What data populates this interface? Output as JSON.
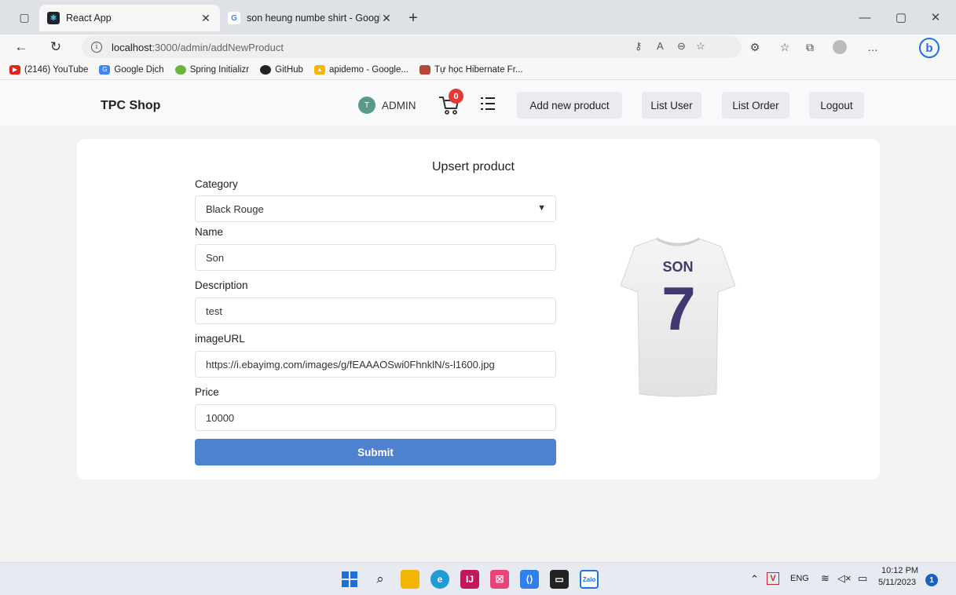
{
  "browser": {
    "tabs": [
      {
        "title": "React App",
        "active": true
      },
      {
        "title": "son heung numbe shirt - Google",
        "active": false
      }
    ],
    "url_host": "localhost",
    "url_rest": ":3000/admin/addNewProduct",
    "bookmarks": [
      {
        "label": "(2146) YouTube",
        "color": "#e62117"
      },
      {
        "label": "Google Dịch",
        "color": "#4285f4"
      },
      {
        "label": "Spring Initializr",
        "color": "#6db33f"
      },
      {
        "label": "GitHub",
        "color": "#222222"
      },
      {
        "label": "apidemo - Google...",
        "color": "#f4b400"
      },
      {
        "label": "Tự học Hibernate Fr...",
        "color": "#b24a3a"
      }
    ]
  },
  "navbar": {
    "brand": "TPC Shop",
    "avatar_initial": "T",
    "user_label": "ADMIN",
    "cart_count": "0",
    "buttons": [
      "Add new product",
      "List User",
      "List Order",
      "Logout"
    ]
  },
  "form": {
    "title": "Upsert product",
    "category_label": "Category",
    "category_value": "Black Rouge",
    "name_label": "Name",
    "name_value": "Son",
    "description_label": "Description",
    "description_value": "test",
    "image_label": "imageURL",
    "image_value": "https://i.ebayimg.com/images/g/fEAAAOSwi0FhnklN/s-l1600.jpg",
    "price_label": "Price",
    "price_value": "10000",
    "submit_label": "Submit"
  },
  "preview": {
    "shirt_name": "SON",
    "shirt_number": "7"
  },
  "taskbar": {
    "language": "ENG",
    "time": "10:12 PM",
    "date": "5/11/2023",
    "notification_count": "1"
  },
  "colors": {
    "accent": "#4e82cf",
    "badge": "#e53935",
    "avatar": "#5a9a8a"
  }
}
